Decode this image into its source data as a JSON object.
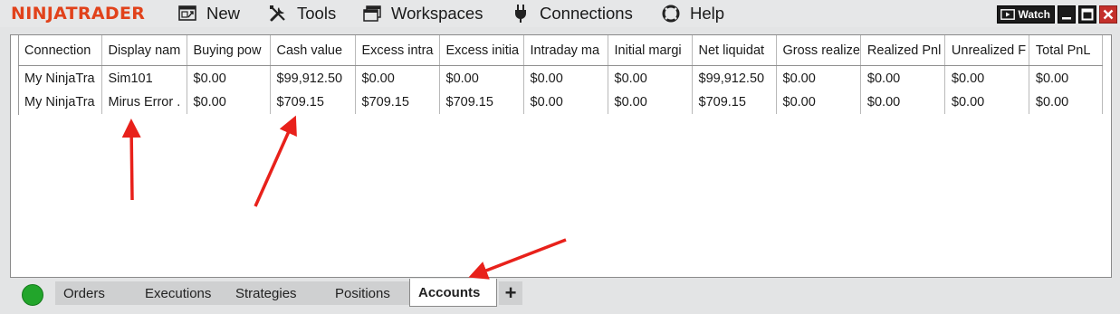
{
  "app": {
    "logo_text": "NINJATRADER",
    "brand_color": "#e1421b"
  },
  "menu": {
    "new": {
      "label": "New",
      "icon": "new-window-icon"
    },
    "tools": {
      "label": "Tools",
      "icon": "tools-icon"
    },
    "workspaces": {
      "label": "Workspaces",
      "icon": "workspaces-icon"
    },
    "connections": {
      "label": "Connections",
      "icon": "plug-icon"
    },
    "help": {
      "label": "Help",
      "icon": "help-lifebuoy-icon"
    }
  },
  "window_controls": {
    "watch_label": "Watch"
  },
  "grid": {
    "columns": [
      "Connection",
      "Display nam",
      "Buying pow",
      "Cash value",
      "Excess intra",
      "Excess initia",
      "Intraday ma",
      "Initial margi",
      "Net liquidat",
      "Gross realize",
      "Realized Pnl",
      "Unrealized F",
      "Total PnL"
    ],
    "rows": [
      [
        "My NinjaTra",
        "Sim101",
        "$0.00",
        "$99,912.50",
        "$0.00",
        "$0.00",
        "$0.00",
        "$0.00",
        "$99,912.50",
        "$0.00",
        "$0.00",
        "$0.00",
        "$0.00"
      ],
      [
        "My NinjaTra",
        "Mirus Error .",
        "$0.00",
        "$709.15",
        "$709.15",
        "$709.15",
        "$0.00",
        "$0.00",
        "$709.15",
        "$0.00",
        "$0.00",
        "$0.00",
        "$0.00"
      ]
    ]
  },
  "tabs": {
    "orders": "Orders",
    "executions": "Executions",
    "strategies": "Strategies",
    "positions": "Positions",
    "accounts": "Accounts",
    "add": "+",
    "active": "Accounts"
  },
  "status": {
    "connection_color": "#22a52b"
  },
  "annotations": {
    "arrow_color": "#e8211b"
  }
}
